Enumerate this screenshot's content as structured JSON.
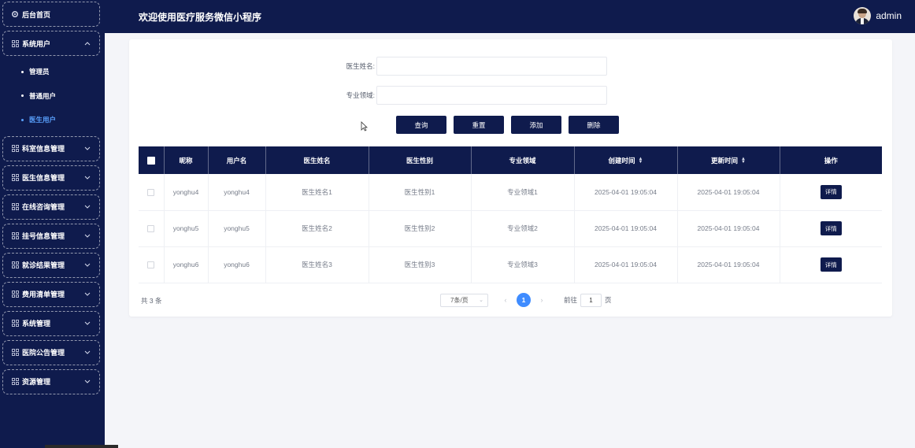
{
  "sidebar": {
    "items": [
      {
        "label": "后台首页",
        "icon": "gear-icon",
        "chevron": ""
      },
      {
        "label": "系统用户",
        "icon": "grid-icon",
        "chevron": "up"
      },
      {
        "label": "科室信息管理",
        "icon": "grid-icon",
        "chevron": "down"
      },
      {
        "label": "医生信息管理",
        "icon": "grid-icon",
        "chevron": "down"
      },
      {
        "label": "在线咨询管理",
        "icon": "grid-icon",
        "chevron": "down"
      },
      {
        "label": "挂号信息管理",
        "icon": "grid-icon",
        "chevron": "down"
      },
      {
        "label": "就诊结果管理",
        "icon": "grid-icon",
        "chevron": "down"
      },
      {
        "label": "费用清单管理",
        "icon": "grid-icon",
        "chevron": "down"
      },
      {
        "label": "系统管理",
        "icon": "grid-icon",
        "chevron": "down"
      },
      {
        "label": "医院公告管理",
        "icon": "grid-icon",
        "chevron": "down"
      },
      {
        "label": "资源管理",
        "icon": "grid-icon",
        "chevron": "down"
      }
    ],
    "sub_items": [
      {
        "label": "管理员",
        "active": false
      },
      {
        "label": "普通用户",
        "active": false
      },
      {
        "label": "医生用户",
        "active": true
      }
    ],
    "active_color": "#5aa2ff"
  },
  "header": {
    "title": "欢迎使用医疗服务微信小程序",
    "username": "admin"
  },
  "search": {
    "doctor_name_label": "医生姓名:",
    "doctor_name_value": "",
    "specialty_label": "专业领域:",
    "specialty_value": ""
  },
  "buttons": {
    "query": "查询",
    "reset": "重置",
    "add": "添加",
    "delete": "删除"
  },
  "table": {
    "headers": [
      "昵称",
      "用户名",
      "医生姓名",
      "医生性别",
      "专业领域",
      "创建时间",
      "更新时间",
      "操作"
    ],
    "rows": [
      {
        "nickname": "yonghu4",
        "username": "yonghu4",
        "doctor_name": "医生姓名1",
        "doctor_gender": "医生性别1",
        "specialty": "专业领域1",
        "created": "2025-04-01 19:05:04",
        "updated": "2025-04-01 19:05:04",
        "action": "详情"
      },
      {
        "nickname": "yonghu5",
        "username": "yonghu5",
        "doctor_name": "医生姓名2",
        "doctor_gender": "医生性别2",
        "specialty": "专业领域2",
        "created": "2025-04-01 19:05:04",
        "updated": "2025-04-01 19:05:04",
        "action": "详情"
      },
      {
        "nickname": "yonghu6",
        "username": "yonghu6",
        "doctor_name": "医生姓名3",
        "doctor_gender": "医生性别3",
        "specialty": "专业领域3",
        "created": "2025-04-01 19:05:04",
        "updated": "2025-04-01 19:05:04",
        "action": "详情"
      }
    ]
  },
  "pagination": {
    "total": "共 3 条",
    "page_size": "7条/页",
    "current_page": "1",
    "goto_label": "前往",
    "goto_value": "1",
    "page_suffix": "页"
  },
  "colors": {
    "primary": "#0f1b4d",
    "page_active": "#3f8cff"
  }
}
